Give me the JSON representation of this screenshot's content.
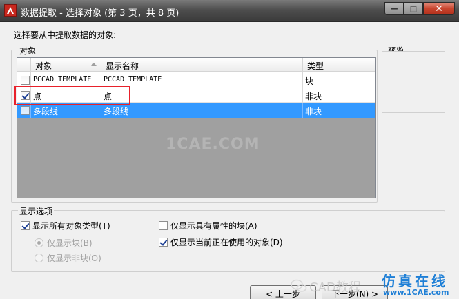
{
  "window": {
    "title": "数据提取 - 选择对象 (第 3 页，共 8 页)",
    "controls": {
      "minimize": "—",
      "maximize": "□",
      "close": "✕"
    }
  },
  "instruction": "选择要从中提取数据的对象:",
  "objects_group": {
    "label": "对象",
    "columns": [
      "对象",
      "显示名称",
      "类型"
    ],
    "rows": [
      {
        "checked": false,
        "object": "PCCAD_TEMPLATE",
        "display_name": "PCCAD_TEMPLATE",
        "type": "块",
        "selected": false
      },
      {
        "checked": true,
        "object": "点",
        "display_name": "点",
        "type": "非块",
        "selected": false
      },
      {
        "checked": false,
        "object": "多段线",
        "display_name": "多段线",
        "type": "非块",
        "selected": true
      }
    ]
  },
  "preview": {
    "label": "预览"
  },
  "display_options": {
    "label": "显示选项",
    "show_all_types": {
      "label": "显示所有对象类型(T)",
      "checked": true
    },
    "only_blocks": {
      "label": "仅显示块(B)",
      "checked": true,
      "enabled": false
    },
    "only_non_blocks": {
      "label": "仅显示非块(O)",
      "checked": false,
      "enabled": false
    },
    "only_attr_blocks": {
      "label": "仅显示具有属性的块(A)",
      "checked": false
    },
    "only_in_use": {
      "label": "仅显示当前正在使用的对象(D)",
      "checked": true
    }
  },
  "buttons": {
    "back": "< 上一步",
    "next": "下一步(N) >"
  },
  "watermarks": {
    "center": "1CAE.COM",
    "wechat": "CAD教程",
    "brand_cn": "仿真在线",
    "brand_url": "www.1CAE.com"
  },
  "colors": {
    "selection": "#3399ff",
    "highlight_box": "#e8212b",
    "titlebar": "#4e4e4e"
  }
}
